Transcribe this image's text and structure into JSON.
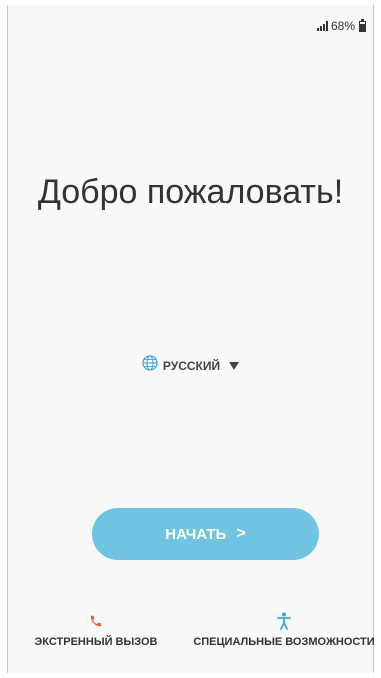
{
  "status_bar": {
    "battery_percent": "68%",
    "battery_level": 0.68
  },
  "welcome": {
    "title": "Добро пожаловать!"
  },
  "language": {
    "selected": "РУССКИЙ"
  },
  "start": {
    "label": "НАЧАТЬ",
    "arrow": ">"
  },
  "bottom": {
    "emergency_label": "ЭКСТРЕННЫЙ ВЫЗОВ",
    "accessibility_label": "СПЕЦИАЛЬНЫЕ ВОЗМОЖНОСТИ"
  },
  "colors": {
    "accent": "#71c4e1",
    "emergency_icon": "#e0635a",
    "accessibility_icon": "#3aa9cf"
  },
  "icons": {
    "signal": "signal-icon",
    "battery": "battery-icon",
    "globe": "globe-icon",
    "dropdown": "triangle-down-icon",
    "phone": "phone-icon",
    "accessibility": "accessibility-icon"
  }
}
